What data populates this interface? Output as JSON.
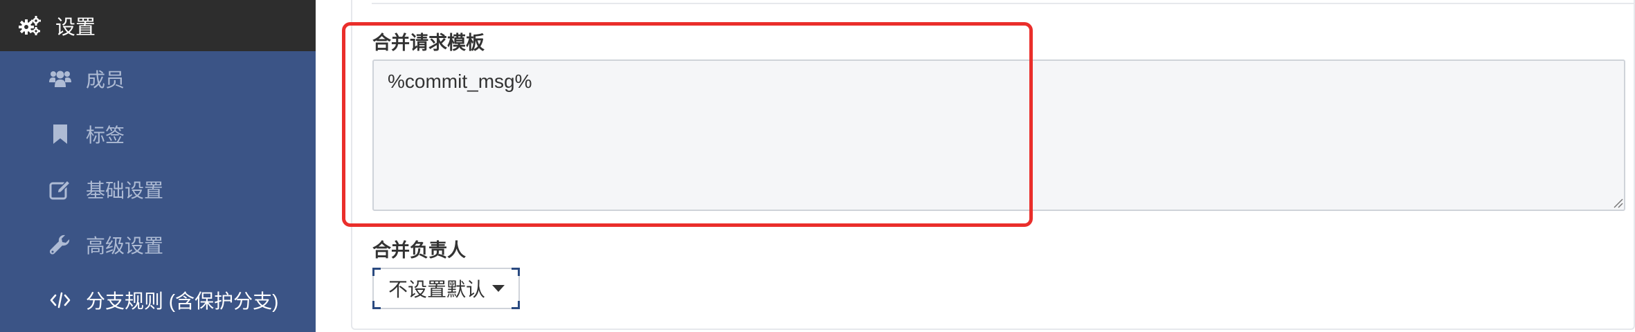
{
  "sidebar": {
    "header": {
      "label": "设置",
      "icon": "gears-icon"
    },
    "items": [
      {
        "label": "成员",
        "icon": "users-icon",
        "active": false
      },
      {
        "label": "标签",
        "icon": "bookmark-icon",
        "active": false
      },
      {
        "label": "基础设置",
        "icon": "edit-icon",
        "active": false
      },
      {
        "label": "高级设置",
        "icon": "wrench-icon",
        "active": false
      },
      {
        "label": "分支规则 (含保护分支)",
        "icon": "code-icon",
        "active": true
      }
    ]
  },
  "main": {
    "merge_template": {
      "label": "合并请求模板",
      "value": "%commit_msg%"
    },
    "merge_owner": {
      "label": "合并负责人",
      "selected": "不设置默认"
    }
  },
  "colors": {
    "sidebar_bg": "#3b5486",
    "sidebar_header_bg": "#2d2d2d",
    "highlight": "#ea2e2b"
  }
}
